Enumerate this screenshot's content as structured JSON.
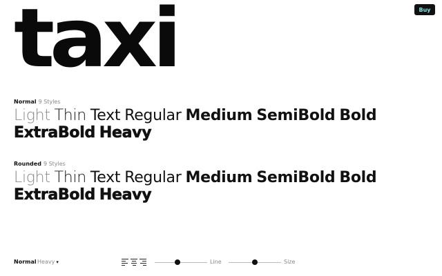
{
  "header": {
    "buy_label": "Buy"
  },
  "logo": {
    "text": "taxi"
  },
  "sections": [
    {
      "name": "Normal",
      "count": "9 Styles",
      "styles": [
        "Light",
        "Thin",
        "Text",
        "Regular",
        "Medium",
        "SemiBold",
        "Bold",
        "ExtraBold",
        "Heavy"
      ]
    },
    {
      "name": "Rounded",
      "count": "9 Styles",
      "styles": [
        "Light",
        "Thin",
        "Text",
        "Regular",
        "Medium",
        "SemiBold",
        "Bold",
        "ExtraBold",
        "Heavy"
      ]
    }
  ],
  "toolbar": {
    "style_name": "Normal",
    "weight": "Heavy",
    "weight_caret": "▾",
    "alignment_selected": "left",
    "line_label": "Line",
    "line_value": 0.44,
    "size_label": "Size",
    "size_value": 0.5
  }
}
